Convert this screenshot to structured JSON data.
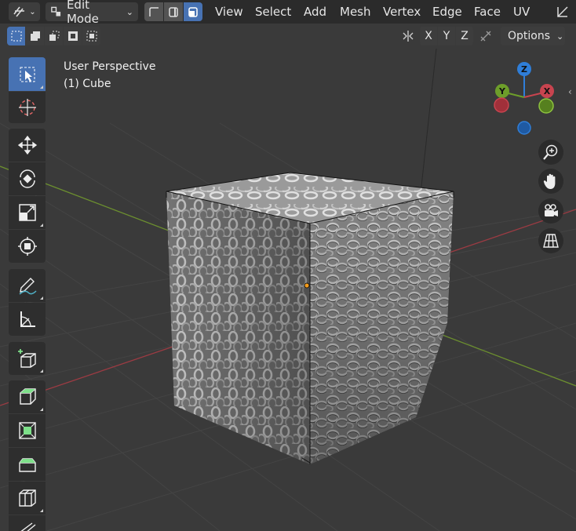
{
  "header": {
    "mode": "Edit Mode",
    "menu": [
      "View",
      "Select",
      "Add",
      "Mesh",
      "Vertex",
      "Edge",
      "Face",
      "UV"
    ]
  },
  "tool_header": {
    "axes": [
      "X",
      "Y",
      "Z"
    ],
    "options_label": "Options"
  },
  "viewport": {
    "view_name": "User Perspective",
    "object_name": "(1) Cube"
  },
  "gizmo": {
    "labels": [
      "Z",
      "Y",
      "X"
    ]
  },
  "colors": {
    "accent": "#4772b3",
    "axis_x": "#c8444f",
    "axis_y": "#6d9e2a",
    "axis_z": "#2f7ed8"
  }
}
